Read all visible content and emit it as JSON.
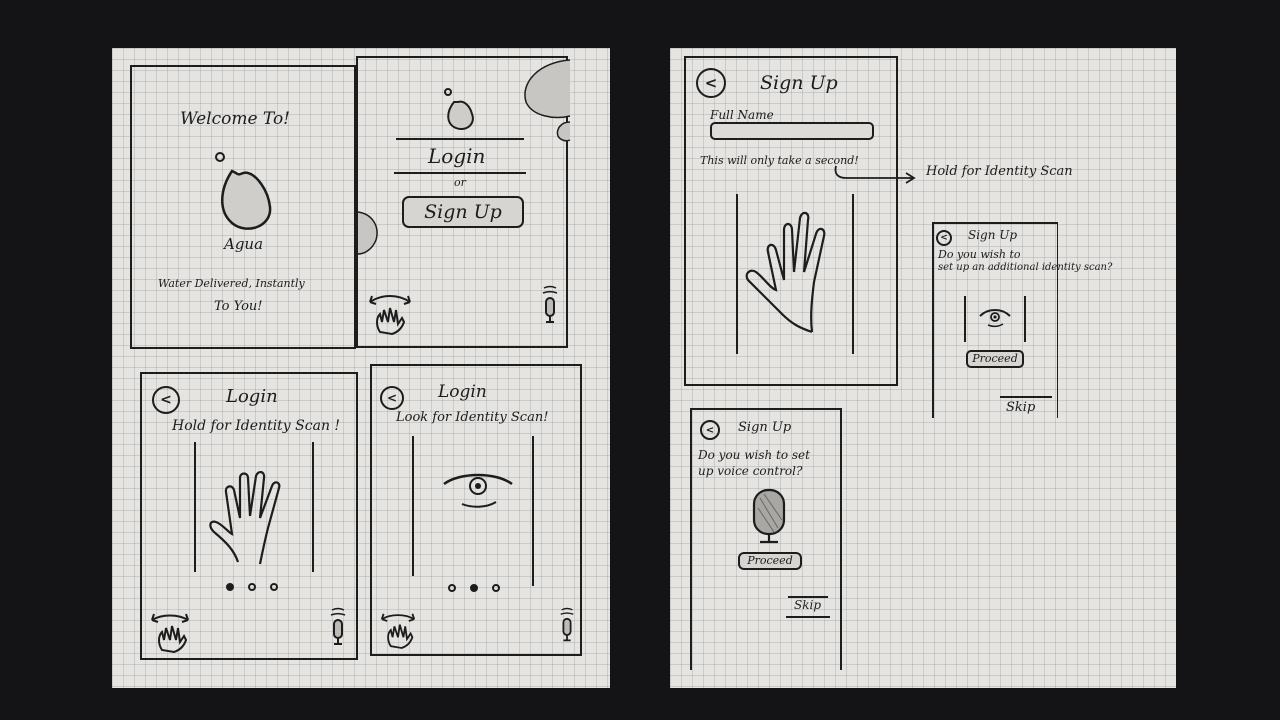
{
  "screens": {
    "welcome": {
      "heading": "Welcome To!",
      "app_name": "Agua",
      "tagline_1": "Water Delivered, Instantly",
      "tagline_2": "To You!"
    },
    "landing": {
      "login_label": "Login",
      "or_label": "or",
      "signup_label": "Sign Up"
    },
    "login_hand": {
      "title": "Login",
      "instruction": "Hold for Identity Scan !"
    },
    "login_eye": {
      "title": "Login",
      "instruction": "Look for Identity Scan!"
    },
    "signup_main": {
      "title": "Sign Up",
      "full_name_label": "Full Name",
      "note": "This will only take a second!",
      "annotation": "Hold for Identity Scan"
    },
    "signup_additional": {
      "title": "Sign Up",
      "question_1": "Do you wish to",
      "question_2": "set up an additional identity scan?",
      "proceed_label": "Proceed",
      "skip_label": "Skip"
    },
    "signup_voice": {
      "title": "Sign Up",
      "question_1": "Do you wish to set",
      "question_2": "up voice control?",
      "proceed_label": "Proceed",
      "skip_label": "Skip"
    }
  },
  "icons": {
    "back": "<",
    "water_drop": "water-drop-icon",
    "hand": "hand-icon",
    "eye": "eye-icon",
    "microphone": "microphone-icon"
  },
  "colors": {
    "background": "#141315",
    "paper": "#e6e4e1",
    "ink": "#1d1d1d"
  }
}
